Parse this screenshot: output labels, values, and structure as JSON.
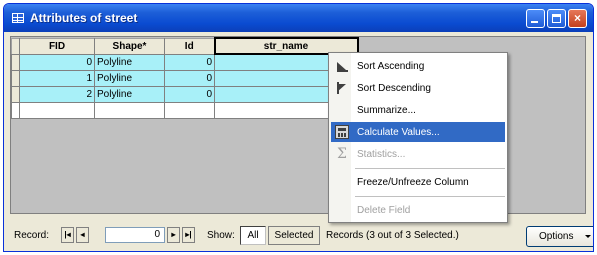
{
  "window": {
    "title": "Attributes of street",
    "minimize_glyph": "",
    "maximize_glyph": "",
    "close_glyph": "×"
  },
  "table": {
    "columns": [
      "FID",
      "Shape*",
      "Id",
      "str_name"
    ],
    "rows": [
      {
        "fid": "0",
        "shape": "Polyline",
        "id": "0",
        "str_name": ""
      },
      {
        "fid": "1",
        "shape": "Polyline",
        "id": "0",
        "str_name": ""
      },
      {
        "fid": "2",
        "shape": "Polyline",
        "id": "0",
        "str_name": ""
      }
    ]
  },
  "context_menu": {
    "items": [
      {
        "label": "Sort Ascending",
        "icon": "sort-ascending-icon",
        "enabled": true
      },
      {
        "label": "Sort Descending",
        "icon": "sort-descending-icon",
        "enabled": true
      },
      {
        "label": "Summarize...",
        "icon": "",
        "enabled": true
      },
      {
        "label": "Calculate Values...",
        "icon": "calculator-icon",
        "enabled": true,
        "highlighted": true
      },
      {
        "label": "Statistics...",
        "icon": "sigma-icon",
        "enabled": false
      },
      {
        "label": "Freeze/Unfreeze Column",
        "icon": "",
        "enabled": true
      },
      {
        "label": "Delete Field",
        "icon": "",
        "enabled": false
      }
    ]
  },
  "statusbar": {
    "record_label": "Record:",
    "record_value": "0",
    "nav_first": "|◂",
    "nav_prev": "◂",
    "nav_next": "▸",
    "nav_last": "▸|",
    "show_label": "Show:",
    "show_all": "All",
    "show_selected": "Selected",
    "records_text": "Records  (3 out of 3 Selected.)",
    "options_label": "Options"
  },
  "colors": {
    "selected_row": "#a8f0f8",
    "menu_highlight": "#316ac5",
    "titlebar": "#0a4bd1"
  }
}
